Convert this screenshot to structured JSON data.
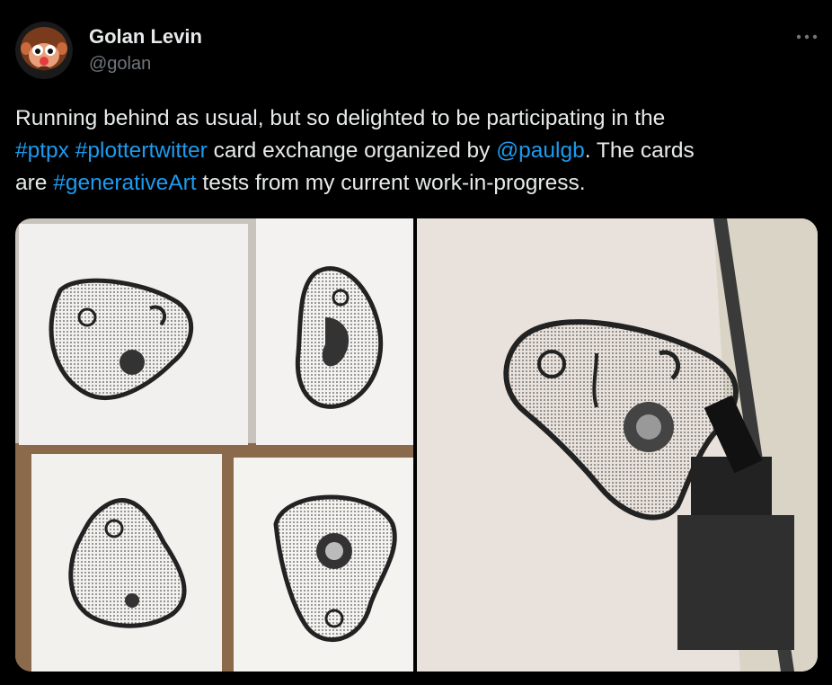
{
  "author": {
    "name": "Golan Levin",
    "handle": "@golan",
    "avatar_icon": "monkey-face-avatar"
  },
  "more_icon": "more-horizontal-icon",
  "tweet": {
    "segments": [
      [
        {
          "text": "Running behind as usual, but so delighted to be participating in the",
          "type": "text"
        }
      ],
      [
        {
          "text": "#ptpx",
          "type": "hashtag"
        },
        {
          "text": " ",
          "type": "text"
        },
        {
          "text": "#plottertwitter",
          "type": "hashtag"
        },
        {
          "text": " card exchange organized by ",
          "type": "text"
        },
        {
          "text": "@paulgb",
          "type": "mention"
        },
        {
          "text": ". The cards",
          "type": "text"
        }
      ],
      [
        {
          "text": "are ",
          "type": "text"
        },
        {
          "text": "#generativeArt",
          "type": "hashtag"
        },
        {
          "text": " tests from my current work-in-progress.",
          "type": "text"
        }
      ]
    ]
  },
  "media": [
    {
      "name": "photo-plotter-cards-grid"
    },
    {
      "name": "photo-pen-plotter-drawing"
    }
  ],
  "colors": {
    "background": "#000000",
    "text": "#e7e9ea",
    "secondary": "#71767b",
    "link": "#1d9bf0"
  }
}
